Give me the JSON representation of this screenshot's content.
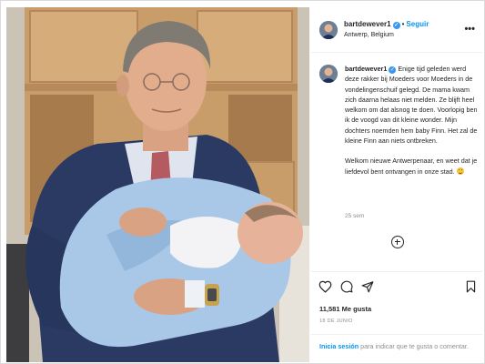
{
  "post": {
    "username": "bartdewever1",
    "verified_mark": "✓",
    "separator": "•",
    "follow_label": "Seguir",
    "location": "Antwerp, Belgium",
    "more_icon": "more-horizontal-icon",
    "caption_username": "bartdewever1",
    "caption_paragraph_1": "Enige tijd geleden werd deze rakker bij Moeders voor Moeders in de vondelingenschuif gelegd. De mama kwam zich daarna helaas niet melden. Ze blijft heel welkom om dat alsnog te doen. Voorlopig ben ik de voogd van dit kleine wonder. Mijn dochters noemden hem baby Finn. Het zal de kleine Finn aan niets ontbreken.",
    "caption_paragraph_2": "Welkom nieuwe Antwerpenaar, en weet dat je liefdevol bent ontvangen in onze stad.",
    "caption_emoji": "smiling-face-emoji",
    "time_ago": "25 sem",
    "likes": "11,581 Me gusta",
    "date": "18 DE JUNIO"
  },
  "icons": {
    "add_comment": "plus-circle-icon",
    "like": "heart-icon",
    "comment": "comment-bubble-icon",
    "share": "paper-plane-icon",
    "save": "bookmark-icon"
  },
  "login": {
    "link_label": "Inicia sesión",
    "rest_text": " para indicar que te gusta o comentar."
  },
  "colors": {
    "link_blue": "#0095f6",
    "verified_blue": "#3897f0",
    "text": "#262626",
    "muted": "#8e8e8e",
    "divider": "#efefef"
  }
}
